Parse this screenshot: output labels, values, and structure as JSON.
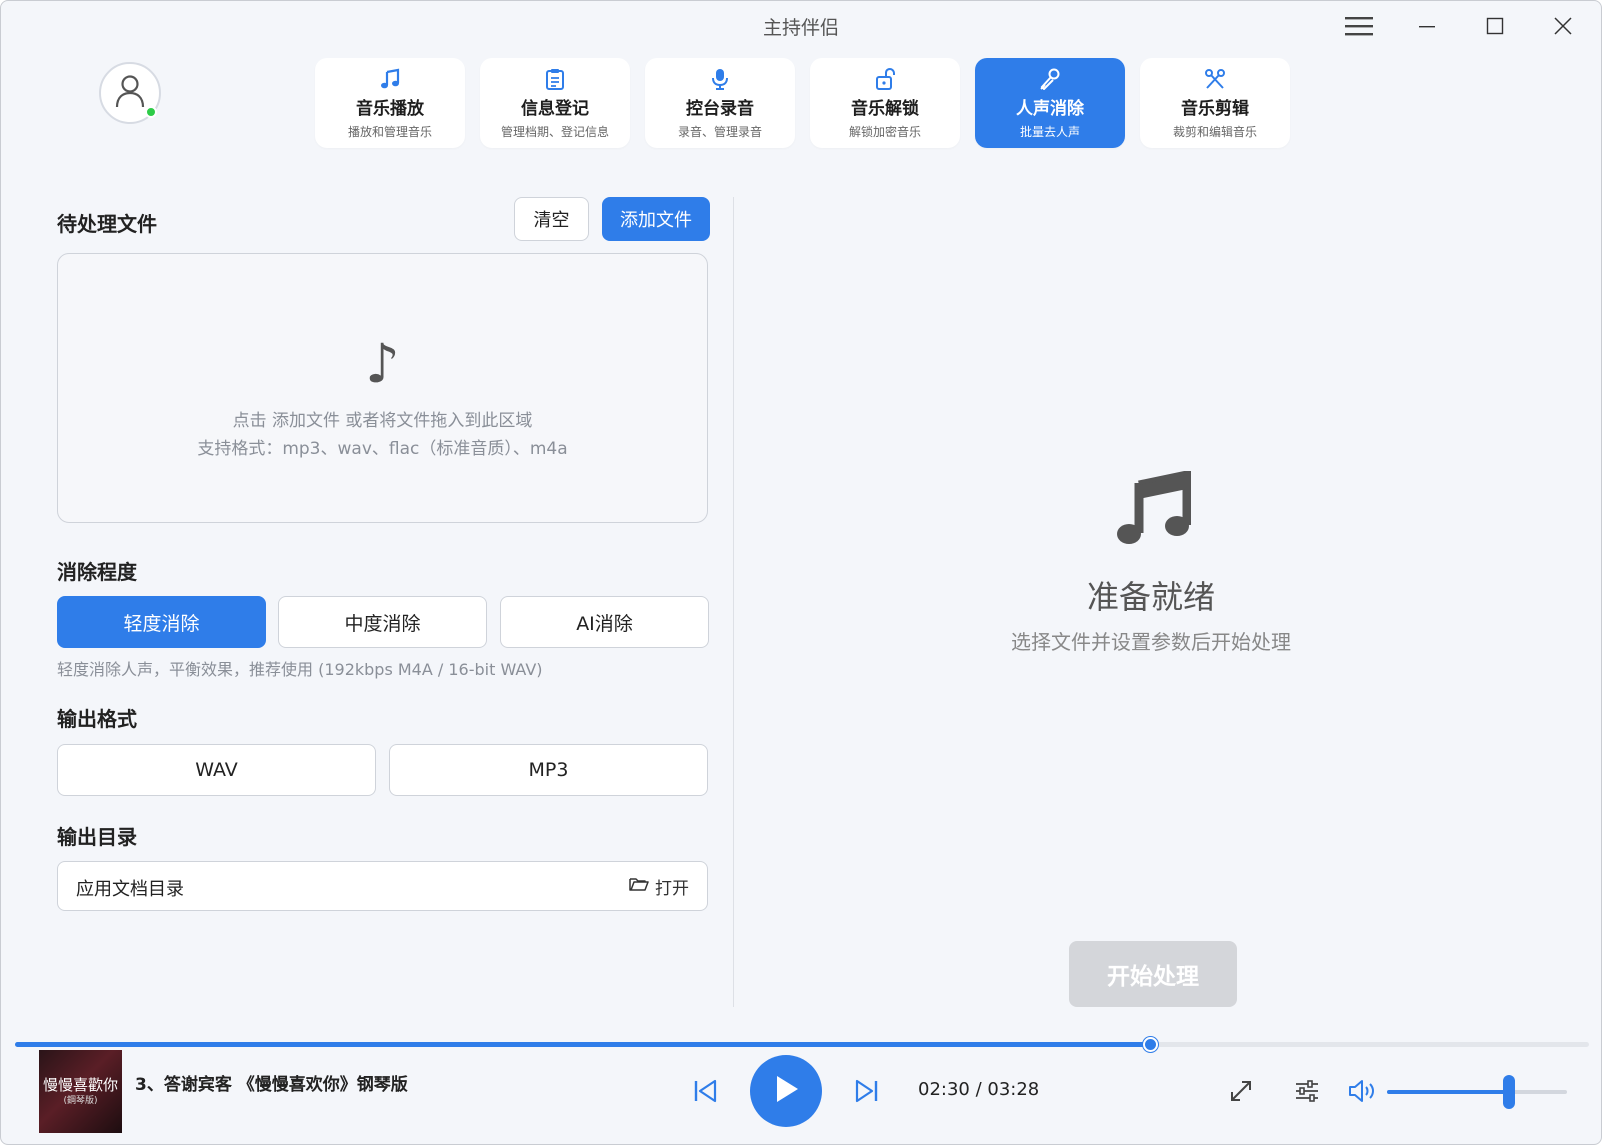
{
  "window": {
    "title": "主持伴侣",
    "menu_icon": "hamburger-menu-icon",
    "minimize_icon": "minimize-icon",
    "maximize_icon": "maximize-icon",
    "close_icon": "close-icon"
  },
  "user": {
    "avatar_icon": "user-icon",
    "status": "online",
    "status_color": "#2ecc48"
  },
  "nav": {
    "items": [
      {
        "title": "音乐播放",
        "sub": "播放和管理音乐",
        "icon": "music-note-icon"
      },
      {
        "title": "信息登记",
        "sub": "管理档期、登记信息",
        "icon": "clipboard-icon"
      },
      {
        "title": "控台录音",
        "sub": "录音、管理录音",
        "icon": "microphone-icon"
      },
      {
        "title": "音乐解锁",
        "sub": "解锁加密音乐",
        "icon": "unlock-icon"
      },
      {
        "title": "人声消除",
        "sub": "批量去人声",
        "icon": "mic-off-icon",
        "active": true
      },
      {
        "title": "音乐剪辑",
        "sub": "裁剪和编辑音乐",
        "icon": "scissors-icon"
      }
    ]
  },
  "files": {
    "title": "待处理文件",
    "clear_label": "清空",
    "add_label": "添加文件",
    "drop_icon": "music-note-icon",
    "drop_hint": "点击 添加文件 或者将文件拖入到此区域",
    "formats_hint": "支持格式：mp3、wav、flac（标准音质）、m4a"
  },
  "level": {
    "title": "消除程度",
    "options": [
      "轻度消除",
      "中度消除",
      "AI消除"
    ],
    "selected": "轻度消除",
    "description": "轻度消除人声，平衡效果，推荐使用 (192kbps M4A / 16-bit WAV)"
  },
  "format": {
    "title": "输出格式",
    "options": [
      "WAV",
      "MP3"
    ]
  },
  "output_dir": {
    "title": "输出目录",
    "value": "应用文档目录",
    "open_label": "打开",
    "open_icon": "folder-open-icon"
  },
  "status": {
    "icon": "music-notes-icon",
    "title": "准备就绪",
    "subtitle": "选择文件并设置参数后开始处理",
    "start_label": "开始处理"
  },
  "player": {
    "cover_text": "慢慢喜歡你",
    "cover_subtext": "(鋼琴版)",
    "track_title": "3、答谢宾客 《慢慢喜欢你》钢琴版",
    "time": "02:30 / 03:28",
    "progress": 0.7213,
    "volume": 0.68,
    "prev_icon": "skip-previous-icon",
    "play_icon": "play-icon",
    "next_icon": "skip-next-icon",
    "expand_icon": "expand-icon",
    "equalizer_icon": "equalizer-icon",
    "volume_icon": "volume-icon"
  },
  "colors": {
    "accent": "#2f7de9",
    "background": "#f4f6fa",
    "disabled": "#d4d6da"
  }
}
